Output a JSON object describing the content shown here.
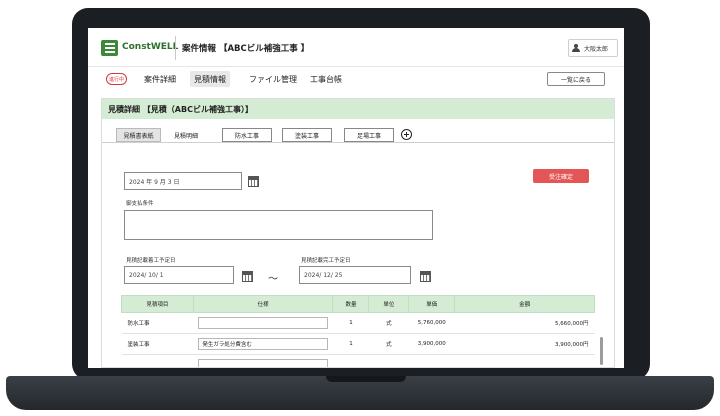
{
  "app": {
    "logo_text": "ConstWELL",
    "page_title": "案件情報 【ABCビル補強工事 】",
    "user_name": "大阪太郎"
  },
  "nav": {
    "status_badge": "進行中",
    "tabs": [
      "案件詳細",
      "見積情報",
      "ファイル管理",
      "工事台帳"
    ],
    "active_tab": "見積情報",
    "back_button": "一覧に戻る"
  },
  "section": {
    "title": "見積詳細 【見積（ABCビル補強工事）】"
  },
  "subtabs": [
    "見積書表紙",
    "見積明細",
    "防水工事",
    "塗装工事",
    "足場工事"
  ],
  "form": {
    "date_value": "2024 年 9 月 3 日",
    "order_button": "受注確定",
    "payment_label": "御支払条件",
    "payment_value": "",
    "start_label": "見積記載着工予定日",
    "start_value": "2024/ 10/ 1",
    "end_label": "見積記載完工予定日",
    "end_value": "2024/ 12/ 25",
    "range_separator": "〜"
  },
  "table": {
    "headers": [
      "見積項目",
      "仕様",
      "数量",
      "単位",
      "単価",
      "金額"
    ],
    "rows": [
      {
        "item": "防水工事",
        "spec": "",
        "qty": "1",
        "unit": "式",
        "price": "5,760,000",
        "amount": "5,660,000円"
      },
      {
        "item": "塗装工事",
        "spec": "発生ガラ処分費含む",
        "qty": "1",
        "unit": "式",
        "price": "3,900,000",
        "amount": "3,900,000円"
      },
      {
        "item": "",
        "spec": "",
        "qty": "",
        "unit": "",
        "price": "",
        "amount": ""
      }
    ]
  },
  "icons": {
    "menu": "menu-icon",
    "user": "user-icon",
    "calendar": "calendar-icon",
    "add_tab": "plus-circle-icon"
  },
  "colors": {
    "brand_green": "#3a8a3a",
    "section_bg": "#d4ecd4",
    "order_button": "#e45555",
    "status_red": "#d23c3c"
  }
}
